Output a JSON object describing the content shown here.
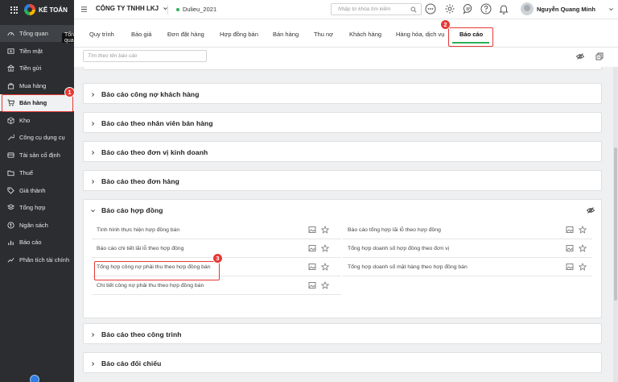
{
  "app": {
    "logo_text": "KẾ TOÁN"
  },
  "sidebar": {
    "tooltip": "Tổng quan",
    "items": [
      {
        "label": "Tổng quan",
        "icon": "gauge-icon"
      },
      {
        "label": "Tiền mặt",
        "icon": "cash-icon"
      },
      {
        "label": "Tiền gửi",
        "icon": "bank-icon"
      },
      {
        "label": "Mua hàng",
        "icon": "bag-icon"
      },
      {
        "label": "Bán hàng",
        "icon": "cart-icon"
      },
      {
        "label": "Kho",
        "icon": "box-icon"
      },
      {
        "label": "Công cụ dụng cụ",
        "icon": "tools-icon"
      },
      {
        "label": "Tài sản cố định",
        "icon": "asset-icon"
      },
      {
        "label": "Thuế",
        "icon": "folder-icon"
      },
      {
        "label": "Giá thành",
        "icon": "tag-icon"
      },
      {
        "label": "Tổng hợp",
        "icon": "layers-icon"
      },
      {
        "label": "Ngân sách",
        "icon": "budget-icon"
      },
      {
        "label": "Báo cáo",
        "icon": "bar-chart-icon"
      },
      {
        "label": "Phân tích tài chính",
        "icon": "trend-icon"
      }
    ],
    "active": "Bán hàng"
  },
  "header": {
    "company": "CÔNG TY TNHH LKJ",
    "dataset": "Dulieu_2021",
    "search_placeholder": "Nhập từ khóa tìm kiếm",
    "username": "Nguyễn Quang Minh"
  },
  "tabs": [
    {
      "label": "Quy trình"
    },
    {
      "label": "Báo giá"
    },
    {
      "label": "Đơn đặt hàng"
    },
    {
      "label": "Hợp đồng bán"
    },
    {
      "label": "Bán hàng"
    },
    {
      "label": "Thu nợ"
    },
    {
      "label": "Khách hàng"
    },
    {
      "label": "Hàng hóa, dịch vụ"
    },
    {
      "label": "Báo cáo"
    }
  ],
  "active_tab": "Báo cáo",
  "filter": {
    "placeholder": "Tìm theo tên báo cáo"
  },
  "panels": [
    {
      "title": "Báo cáo công nợ khách hàng"
    },
    {
      "title": "Báo cáo theo nhân viên bán hàng"
    },
    {
      "title": "Báo cáo theo đơn vị kinh doanh"
    },
    {
      "title": "Báo cáo theo đơn hàng"
    },
    {
      "title": "Báo cáo hợp đồng"
    },
    {
      "title": "Báo cáo theo công trình"
    },
    {
      "title": "Báo cáo đối chiếu"
    }
  ],
  "contract_reports": {
    "left": [
      "Tình hình thực hiện hợp đồng bán",
      "Báo cáo chi tiết lãi lỗ theo hợp đồng",
      "Tổng hợp công nợ phải thu theo hợp đồng bán",
      "Chi tiết công nợ phải thu theo hợp đồng bán"
    ],
    "right": [
      "Báo cáo tổng hợp lãi lỗ theo hợp đồng",
      "Tổng hợp doanh số hợp đồng theo đơn vị",
      "Tổng hợp doanh số mặt hàng theo hợp đồng bán"
    ]
  },
  "callouts": [
    {
      "number": "1"
    },
    {
      "number": "2"
    },
    {
      "number": "3"
    }
  ],
  "colors": {
    "sidebar_bg": "#2b2d30",
    "accent_green": "#2fae5a",
    "callout_red": "#e53935"
  }
}
